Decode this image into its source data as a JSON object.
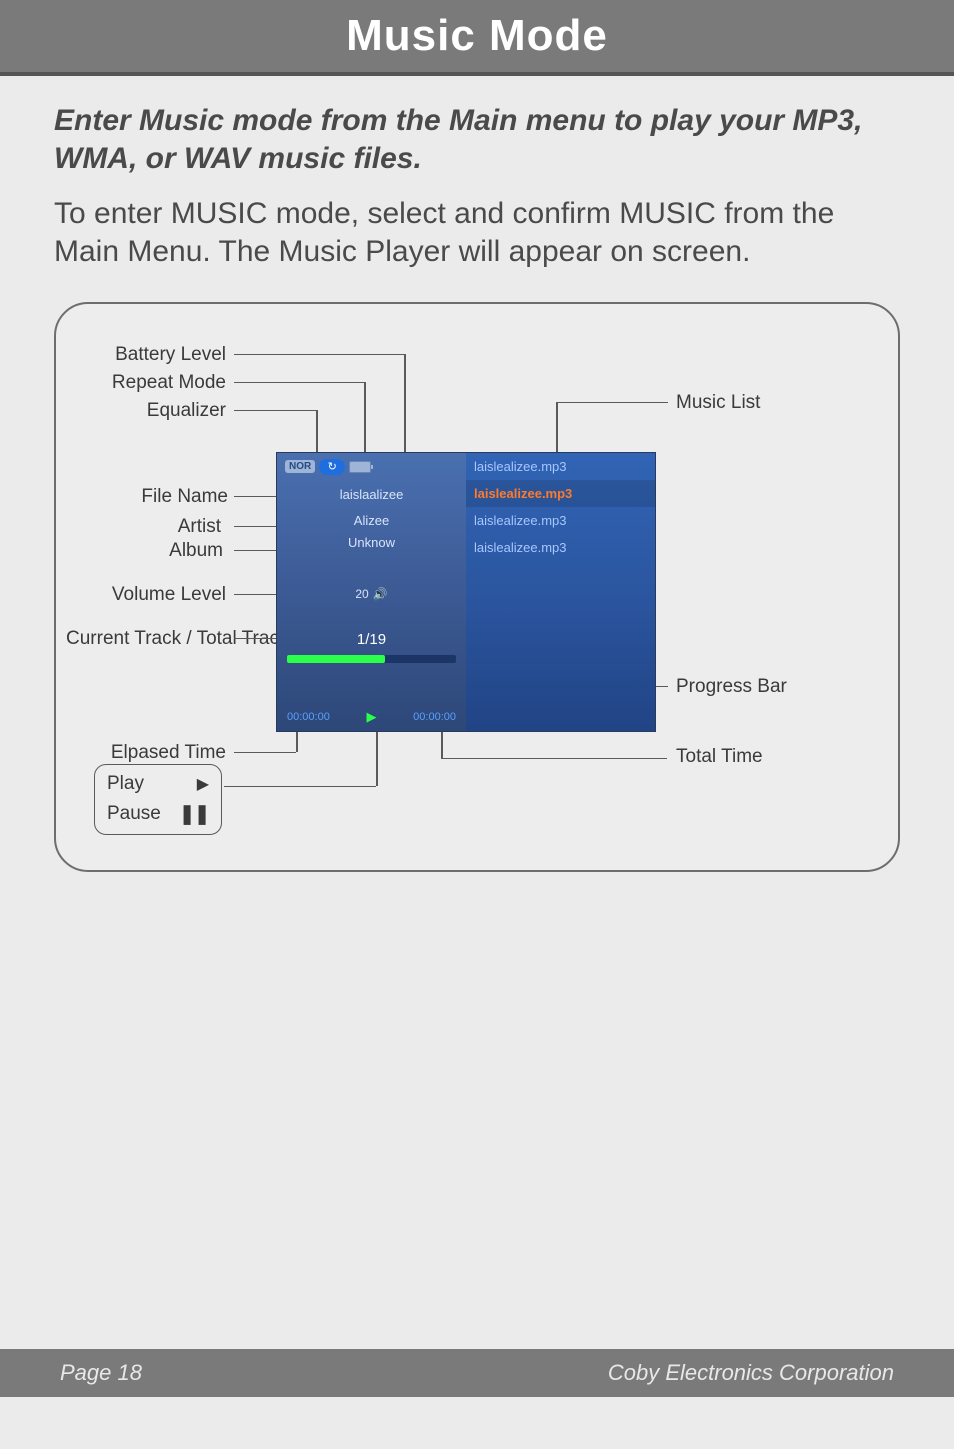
{
  "header": {
    "title": "Music Mode"
  },
  "intro": {
    "lead": "Enter Music mode from the Main menu to play your MP3, WMA, or WAV music files.",
    "body": "To enter MUSIC mode, select and confirm MUSIC from the Main Menu. The Music Player will appear on screen."
  },
  "labels": {
    "battery": "Battery Level",
    "repeat": "Repeat Mode",
    "equalizer": "Equalizer",
    "file_name": "File Name",
    "artist": "Artist",
    "album": "Album",
    "volume": "Volume Level",
    "current_track": "Current Track / Total Tracks",
    "elapsed": "Elpased Time",
    "music_list": "Music List",
    "progress": "Progress Bar",
    "total_time": "Total Time"
  },
  "legend": {
    "play": "Play",
    "pause": "Pause"
  },
  "device": {
    "eq_tag": "NOR",
    "file": "laislaalizee",
    "artist": "Alizee",
    "album": "Unknow",
    "volume": "20",
    "track": "1/19",
    "elapsed": "00:00:00",
    "total": "00:00:00",
    "list": [
      "laislealizee.mp3",
      "laislealizee.mp3",
      "laislealizee.mp3",
      "laislealizee.mp3"
    ]
  },
  "footer": {
    "page": "Page 18",
    "company": "Coby Electronics Corporation"
  }
}
